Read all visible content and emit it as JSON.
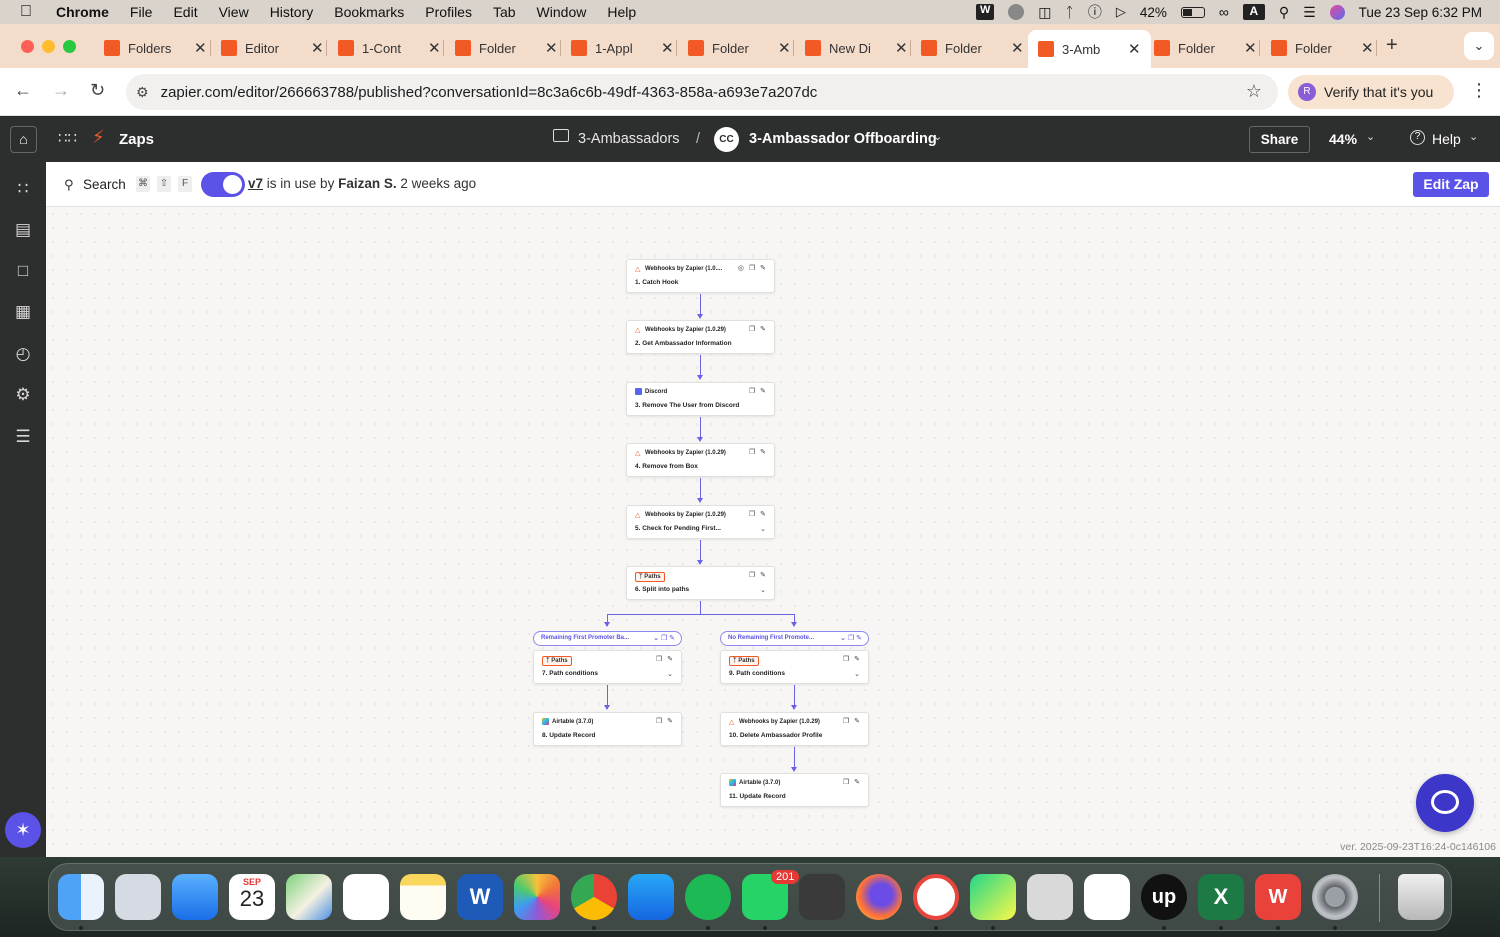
{
  "menubar": {
    "app": "Chrome",
    "items": [
      "File",
      "Edit",
      "View",
      "History",
      "Bookmarks",
      "Profiles",
      "Tab",
      "Window",
      "Help"
    ],
    "battery": "42%",
    "clock": "Tue 23 Sep  6:32 PM"
  },
  "tabs": [
    {
      "label": "Folders"
    },
    {
      "label": "Editor"
    },
    {
      "label": "1-Cont"
    },
    {
      "label": "Folder"
    },
    {
      "label": "1-Appl"
    },
    {
      "label": "Folder"
    },
    {
      "label": "New Di"
    },
    {
      "label": "Folder"
    },
    {
      "label": "3-Amb",
      "active": true
    },
    {
      "label": "Folder"
    },
    {
      "label": "Folder"
    }
  ],
  "address": {
    "url": "zapier.com/editor/266663788/published?conversationId=8c3a6c6b-49df-4363-858a-a693e7a207dc",
    "verify_label": "Verify that it's you",
    "verify_avatar": "R"
  },
  "header": {
    "zaps_label": "Zaps",
    "folder": "3-Ambassadors",
    "separator": "/",
    "avatar_initials": "CC",
    "zap_name": "3-Ambassador Offboarding",
    "share": "Share",
    "zoom": "44%",
    "help": "Help"
  },
  "toolbar": {
    "search_label": "Search",
    "shortcut_keys": [
      "⌘",
      "⇧",
      "F"
    ],
    "version": "v7",
    "status_text": " is in use by ",
    "user": "Faizan S.",
    "time": " 2 weeks ago",
    "edit_button": "Edit Zap",
    "toggle_on": true
  },
  "steps": [
    {
      "id": "s1",
      "app": "Webhooks by Zapier (1.0....",
      "title": "1. Catch Hook"
    },
    {
      "id": "s2",
      "app": "Webhooks by Zapier (1.0.29)",
      "title": "2. Get Ambassador Information"
    },
    {
      "id": "s3",
      "app": "Discord",
      "title": "3. Remove The User from Discord"
    },
    {
      "id": "s4",
      "app": "Webhooks by Zapier (1.0.29)",
      "title": "4. Remove from Box"
    },
    {
      "id": "s5",
      "app": "Webhooks by Zapier (1.0.29)",
      "title": "5. Check for Pending First..."
    },
    {
      "id": "s6",
      "app": "Paths",
      "title": "6. Split into paths"
    },
    {
      "id": "s7",
      "app": "Paths",
      "title": "7. Path conditions"
    },
    {
      "id": "s8",
      "app": "Airtable (3.7.0)",
      "title": "8. Update Record"
    },
    {
      "id": "s9",
      "app": "Paths",
      "title": "9. Path conditions"
    },
    {
      "id": "s10",
      "app": "Webhooks by Zapier (1.0.29)",
      "title": "10. Delete Ambassador Profile"
    },
    {
      "id": "s11",
      "app": "Airtable (3.7.0)",
      "title": "11. Update Record"
    }
  ],
  "paths": [
    {
      "name": "Remaining First Promoter Ba..."
    },
    {
      "name": "No Remaining First Promote..."
    }
  ],
  "version_footer": "ver. 2025-09-23T16:24-0c146106",
  "dock": {
    "calendar_month": "SEP",
    "calendar_day": "23",
    "whatsapp_badge": "201"
  },
  "colors": {
    "zapier_orange": "#f15a24",
    "accent_purple": "#5b52e8",
    "header_dark": "#2d2e2e"
  }
}
